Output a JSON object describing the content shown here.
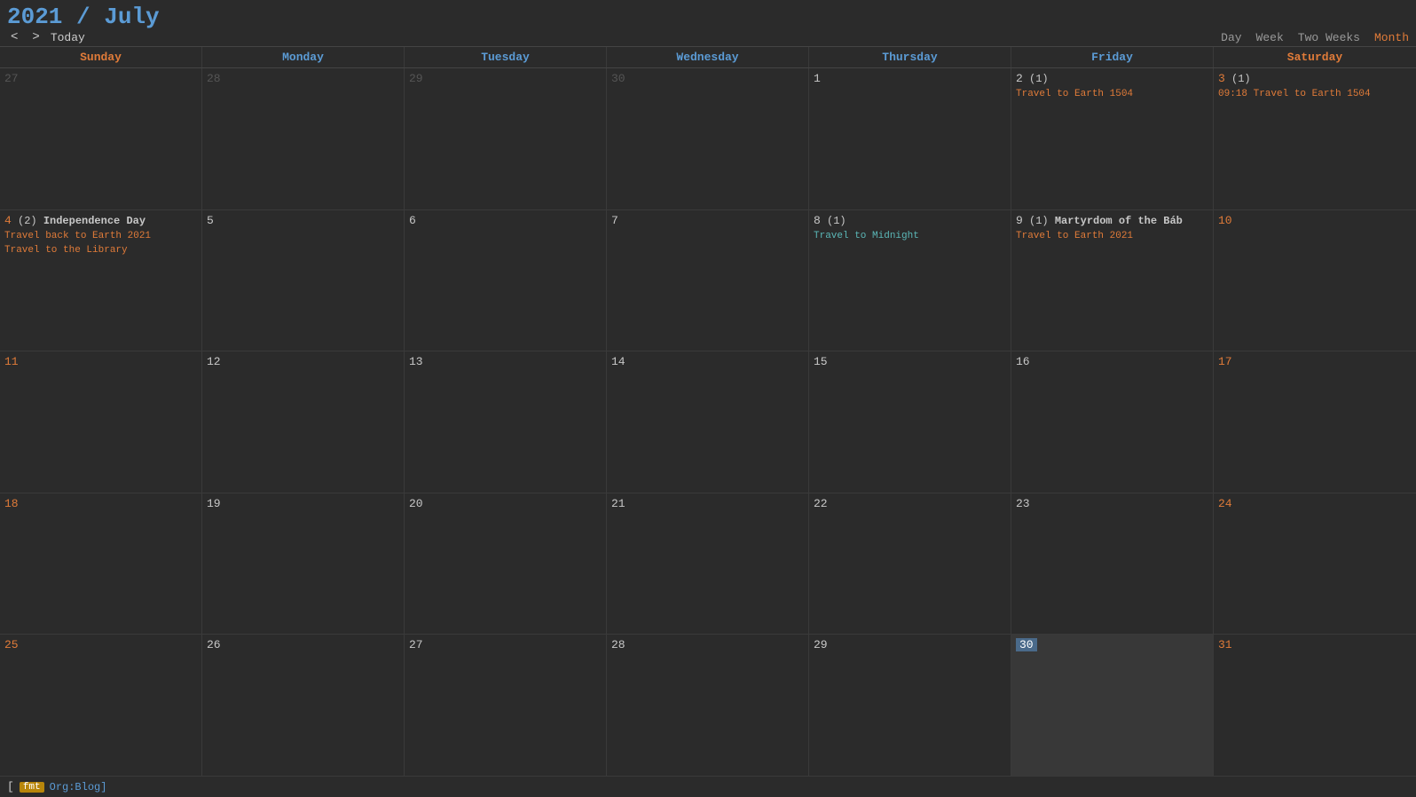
{
  "header": {
    "title_year": "2021",
    "title_month": "July",
    "nav_prev": "<",
    "nav_next": ">",
    "today_label": "Today",
    "views": [
      "Day",
      "Week",
      "Two Weeks",
      "Month"
    ],
    "active_view": "Month"
  },
  "day_headers": [
    {
      "label": "Sunday",
      "type": "weekend"
    },
    {
      "label": "Monday",
      "type": "weekday"
    },
    {
      "label": "Tuesday",
      "type": "weekday"
    },
    {
      "label": "Wednesday",
      "type": "weekday"
    },
    {
      "label": "Thursday",
      "type": "weekday"
    },
    {
      "label": "Friday",
      "type": "weekday"
    },
    {
      "label": "Saturday",
      "type": "weekend"
    }
  ],
  "weeks": [
    {
      "days": [
        {
          "num": "27",
          "type": "out"
        },
        {
          "num": "28",
          "type": "out"
        },
        {
          "num": "29",
          "type": "out"
        },
        {
          "num": "30",
          "type": "out"
        },
        {
          "num": "1",
          "type": "weekday",
          "events": []
        },
        {
          "num": "2",
          "type": "weekday",
          "count": "(1)",
          "events": [
            {
              "text": "Travel to Earth 1504",
              "style": "orange"
            }
          ]
        },
        {
          "num": "3",
          "type": "weekend",
          "count": "(1)",
          "events": [
            {
              "text": "09:18 Travel to Earth 1504",
              "style": "orange"
            }
          ]
        }
      ]
    },
    {
      "days": [
        {
          "num": "4",
          "type": "weekend",
          "count": "(2)",
          "label": "Independence Day",
          "events": [
            {
              "text": "Travel back to Earth 2021",
              "style": "orange"
            },
            {
              "text": "Travel to the Library",
              "style": "orange"
            }
          ]
        },
        {
          "num": "5",
          "type": "weekday",
          "events": []
        },
        {
          "num": "6",
          "type": "weekday",
          "events": []
        },
        {
          "num": "7",
          "type": "weekday",
          "events": []
        },
        {
          "num": "8",
          "type": "weekday",
          "count": "(1)",
          "events": [
            {
              "text": "Travel to Midnight",
              "style": "cyan"
            }
          ]
        },
        {
          "num": "9",
          "type": "weekday",
          "count": "(1)",
          "label": "Martyrdom of the Báb",
          "events": [
            {
              "text": "Travel to Earth 2021",
              "style": "orange"
            }
          ]
        },
        {
          "num": "10",
          "type": "weekend",
          "events": []
        }
      ]
    },
    {
      "days": [
        {
          "num": "11",
          "type": "weekend",
          "events": []
        },
        {
          "num": "12",
          "type": "weekday",
          "events": []
        },
        {
          "num": "13",
          "type": "weekday",
          "events": []
        },
        {
          "num": "14",
          "type": "weekday",
          "events": []
        },
        {
          "num": "15",
          "type": "weekday",
          "events": []
        },
        {
          "num": "16",
          "type": "weekday",
          "events": []
        },
        {
          "num": "17",
          "type": "weekend",
          "events": []
        }
      ]
    },
    {
      "days": [
        {
          "num": "18",
          "type": "weekend",
          "events": []
        },
        {
          "num": "19",
          "type": "weekday",
          "events": []
        },
        {
          "num": "20",
          "type": "weekday",
          "events": []
        },
        {
          "num": "21",
          "type": "weekday",
          "events": []
        },
        {
          "num": "22",
          "type": "weekday",
          "events": []
        },
        {
          "num": "23",
          "type": "weekday",
          "events": []
        },
        {
          "num": "24",
          "type": "weekend",
          "events": []
        }
      ]
    },
    {
      "days": [
        {
          "num": "25",
          "type": "weekend",
          "events": []
        },
        {
          "num": "26",
          "type": "weekday",
          "events": []
        },
        {
          "num": "27",
          "type": "weekday",
          "events": []
        },
        {
          "num": "28",
          "type": "weekday",
          "events": []
        },
        {
          "num": "29",
          "type": "weekday",
          "events": []
        },
        {
          "num": "30",
          "type": "weekday",
          "today": true,
          "events": []
        },
        {
          "num": "31",
          "type": "weekend",
          "events": []
        }
      ]
    }
  ],
  "footer": {
    "tag": "fmt",
    "label": "Org:Blog]"
  }
}
